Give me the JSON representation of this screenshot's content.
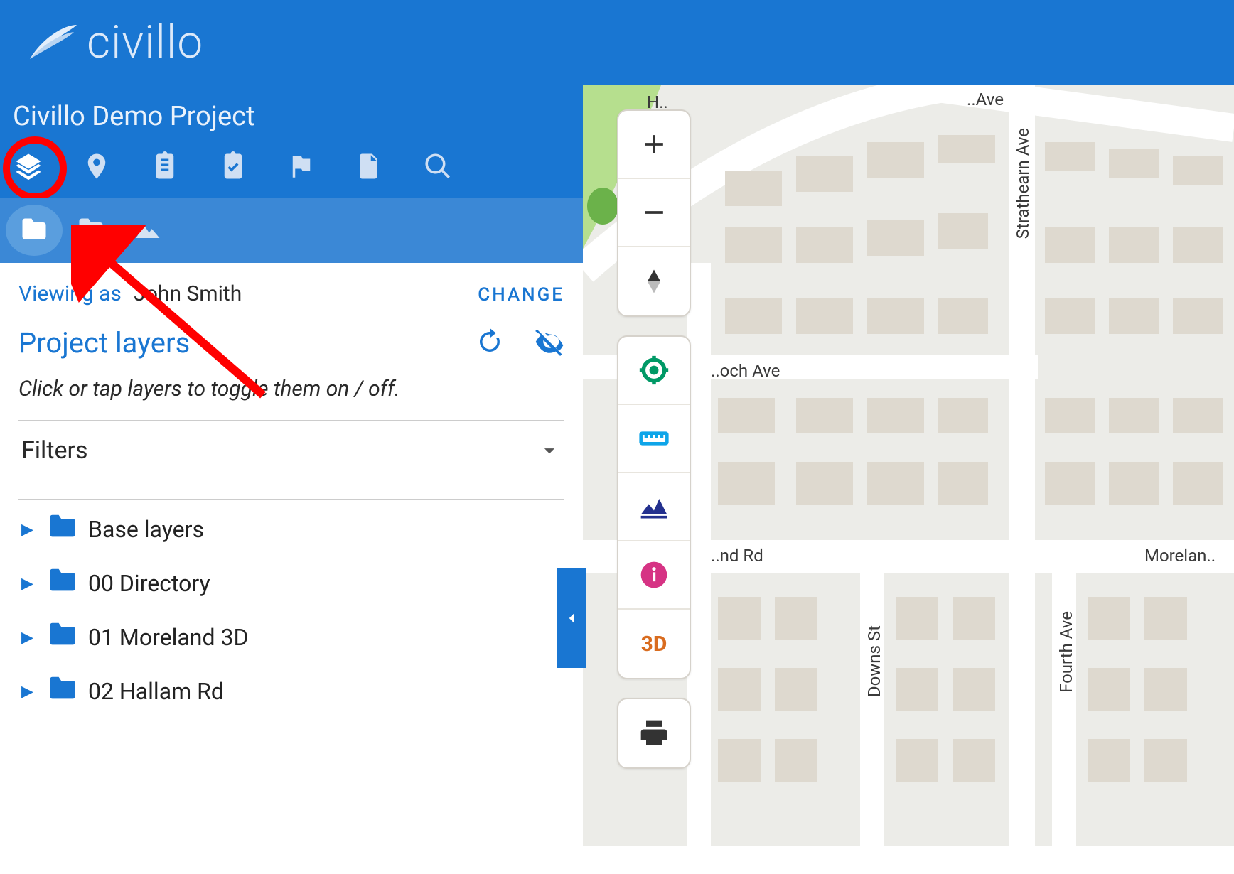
{
  "brand": "civillo",
  "project": {
    "title": "Civillo Demo Project"
  },
  "toolbar": {
    "items": [
      "layers",
      "pin",
      "clipboard",
      "checklist",
      "flag",
      "file",
      "search"
    ],
    "active_index": 0
  },
  "subtabs": {
    "items": [
      "folder",
      "person-folder",
      "terrain"
    ],
    "active_index": 0
  },
  "viewing": {
    "label": "Viewing as",
    "user": "John Smith",
    "change": "CHANGE"
  },
  "section": {
    "title": "Project layers",
    "hint": "Click or tap layers to toggle them on / off.",
    "filters_label": "Filters"
  },
  "layers": [
    {
      "name": "Base layers"
    },
    {
      "name": "00 Directory"
    },
    {
      "name": "01 Moreland 3D"
    },
    {
      "name": "02 Hallam Rd"
    }
  ],
  "annotation": {
    "highlighted_tool": "layers",
    "arrow": true
  },
  "map": {
    "controls_top": [
      "zoom-in",
      "zoom-out",
      "reset-north"
    ],
    "controls_main": [
      "locate",
      "measure",
      "profile",
      "info",
      "3d"
    ],
    "controls_bottom": [
      "print"
    ],
    "three_d_label": "3D",
    "streets": {
      "strathearn": "Strathearn Ave",
      "antoch": "..och Ave",
      "moreland_rd_short": "..nd Rd",
      "moreland_rd": "Morelan..",
      "downs": "Downs St",
      "fourth": "Fourth Ave",
      "top_left": "..Ave",
      "ha": "H.."
    },
    "colors": {
      "park": "#b6df8e",
      "road": "#ffffff",
      "block": "#e5e3dc",
      "building": "#ded9cf"
    }
  },
  "colors": {
    "brand_blue": "#1976d2",
    "annot_red": "#ff0000",
    "locate_green": "#009966",
    "measure_blue": "#0ea5e9",
    "profile_navy": "#23308e",
    "info_pink": "#d63384",
    "three_d_orange": "#d96c1f"
  }
}
